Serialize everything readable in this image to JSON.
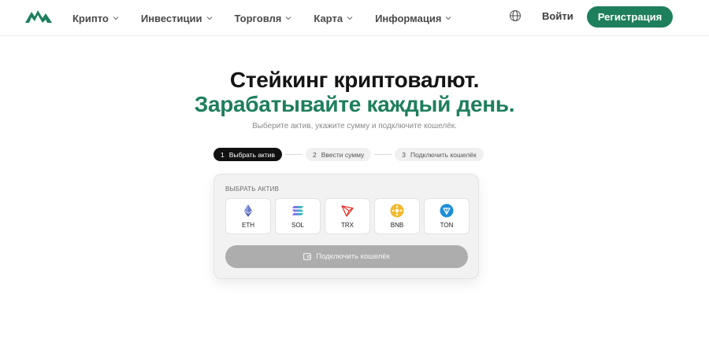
{
  "header": {
    "nav": [
      {
        "label": "Крипто"
      },
      {
        "label": "Инвестиции"
      },
      {
        "label": "Торговля"
      },
      {
        "label": "Карта"
      },
      {
        "label": "Информация"
      }
    ],
    "login_label": "Войти",
    "register_label": "Регистрация"
  },
  "hero": {
    "title_line1": "Стейкинг криптовалют.",
    "title_line2": "Зарабатывайте каждый день.",
    "subtitle": "Выберите актив, укажите сумму и подключите кошелёк."
  },
  "steps": [
    {
      "num": "1",
      "label": "Выбрать актив",
      "active": true
    },
    {
      "num": "2",
      "label": "Ввести сумму",
      "active": false
    },
    {
      "num": "3",
      "label": "Подключить кошелёк",
      "active": false
    }
  ],
  "card": {
    "section_label": "ВЫБРАТЬ АКТИВ",
    "assets": [
      {
        "symbol": "ETH",
        "icon": "ethereum-icon"
      },
      {
        "symbol": "SOL",
        "icon": "solana-icon"
      },
      {
        "symbol": "TRX",
        "icon": "tron-icon"
      },
      {
        "symbol": "BNB",
        "icon": "bnb-icon"
      },
      {
        "symbol": "TON",
        "icon": "ton-icon"
      }
    ],
    "connect_label": "Подключить кошелёк"
  },
  "colors": {
    "brand_green": "#1e7f5c",
    "dark": "#111111",
    "disabled_button": "#adadae"
  }
}
